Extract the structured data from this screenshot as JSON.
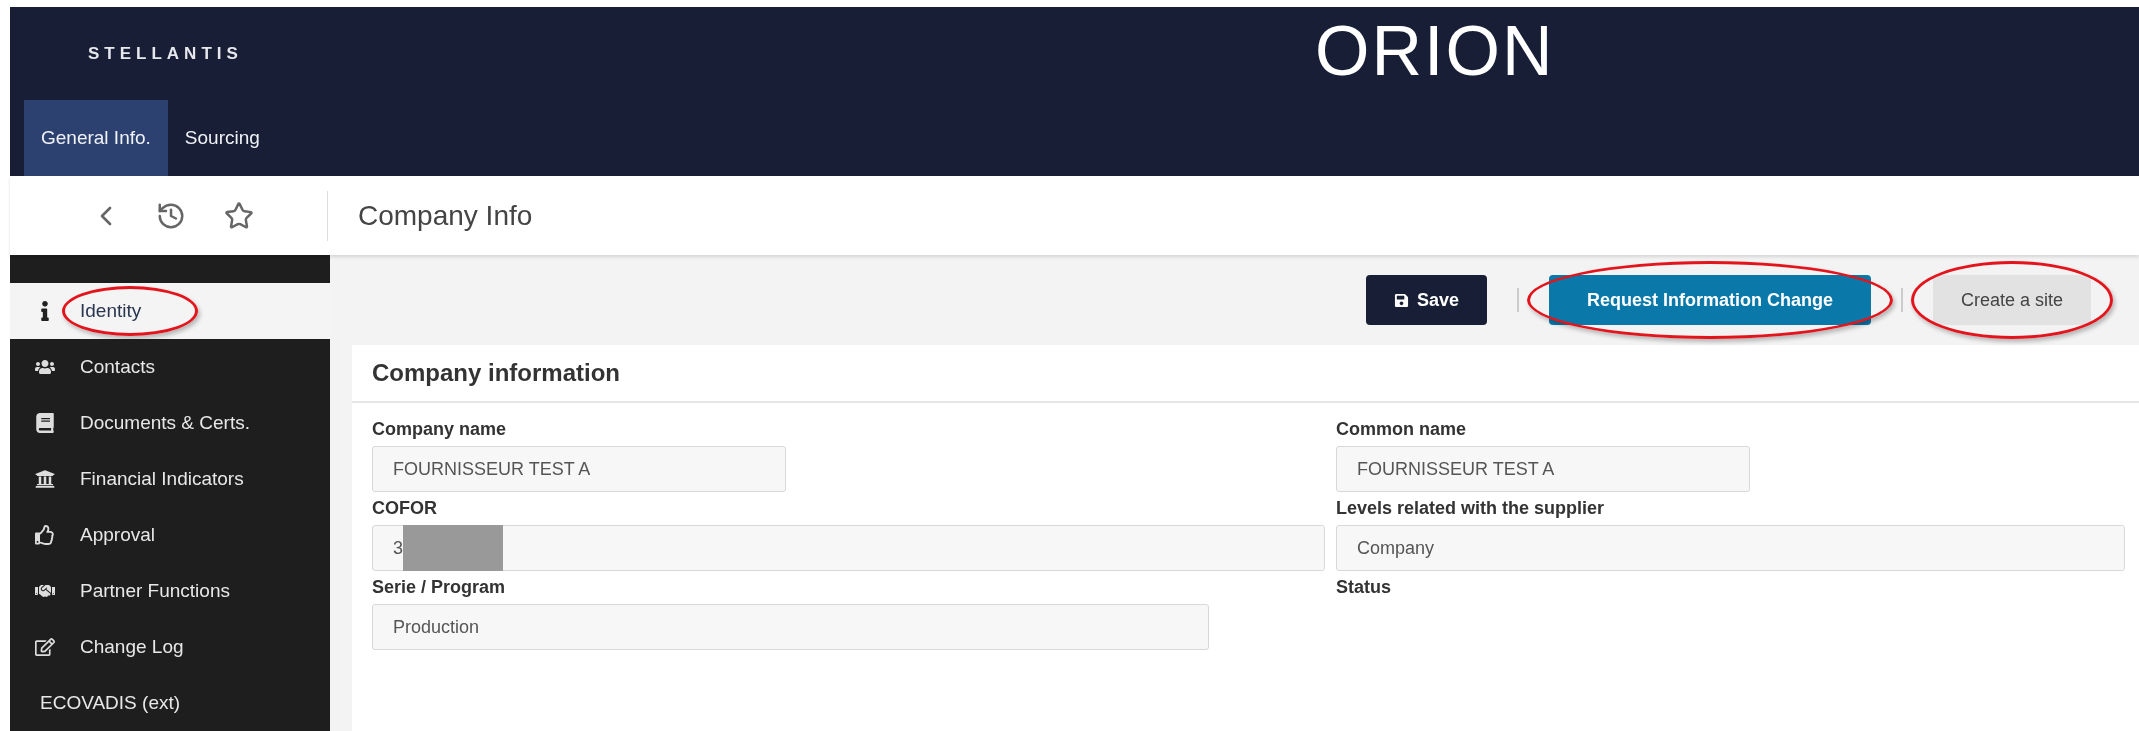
{
  "header": {
    "logo": "STELLANTIS",
    "app_title": "ORION"
  },
  "tabs": [
    {
      "label": "General Info.",
      "selected": true
    },
    {
      "label": "Sourcing",
      "selected": false
    }
  ],
  "page_title": "Company Info",
  "sidebar": {
    "items": [
      {
        "label": "Identity",
        "kind": "page",
        "selected": true,
        "highlighted": true
      },
      {
        "label": "Contacts",
        "kind": "page",
        "selected": false,
        "highlighted": false
      },
      {
        "label": "Documents & Certs.",
        "kind": "page",
        "selected": false,
        "highlighted": false
      },
      {
        "label": "Financial Indicators",
        "kind": "page",
        "selected": false,
        "highlighted": false
      },
      {
        "label": "Approval",
        "kind": "page",
        "selected": false,
        "highlighted": false
      },
      {
        "label": "Partner Functions",
        "kind": "page",
        "selected": false,
        "highlighted": false
      },
      {
        "label": "Change Log",
        "kind": "page",
        "selected": false,
        "highlighted": false
      },
      {
        "label": "ECOVADIS (ext)",
        "kind": "section",
        "selected": false,
        "highlighted": false
      }
    ]
  },
  "actions": [
    {
      "label": "Save",
      "kind": "save",
      "highlighted": false
    },
    {
      "label": "Request Information Change",
      "kind": "primary",
      "highlighted": true
    },
    {
      "label": "Create a site",
      "kind": "secondary",
      "highlighted": true
    }
  ],
  "card": {
    "title": "Company information",
    "fields": [
      {
        "label": "Company name",
        "value": "FOURNISSEUR TEST A",
        "redacted": false
      },
      {
        "label": "Common name",
        "value": "FOURNISSEUR TEST A",
        "redacted": false
      },
      {
        "label": "COFOR",
        "value": "3",
        "redacted": true
      },
      {
        "label": "Levels related with the supplier",
        "value": "Company",
        "redacted": false
      },
      {
        "label": "Serie / Program",
        "value": "Production",
        "redacted": false
      },
      {
        "label": "Status"
      }
    ]
  }
}
